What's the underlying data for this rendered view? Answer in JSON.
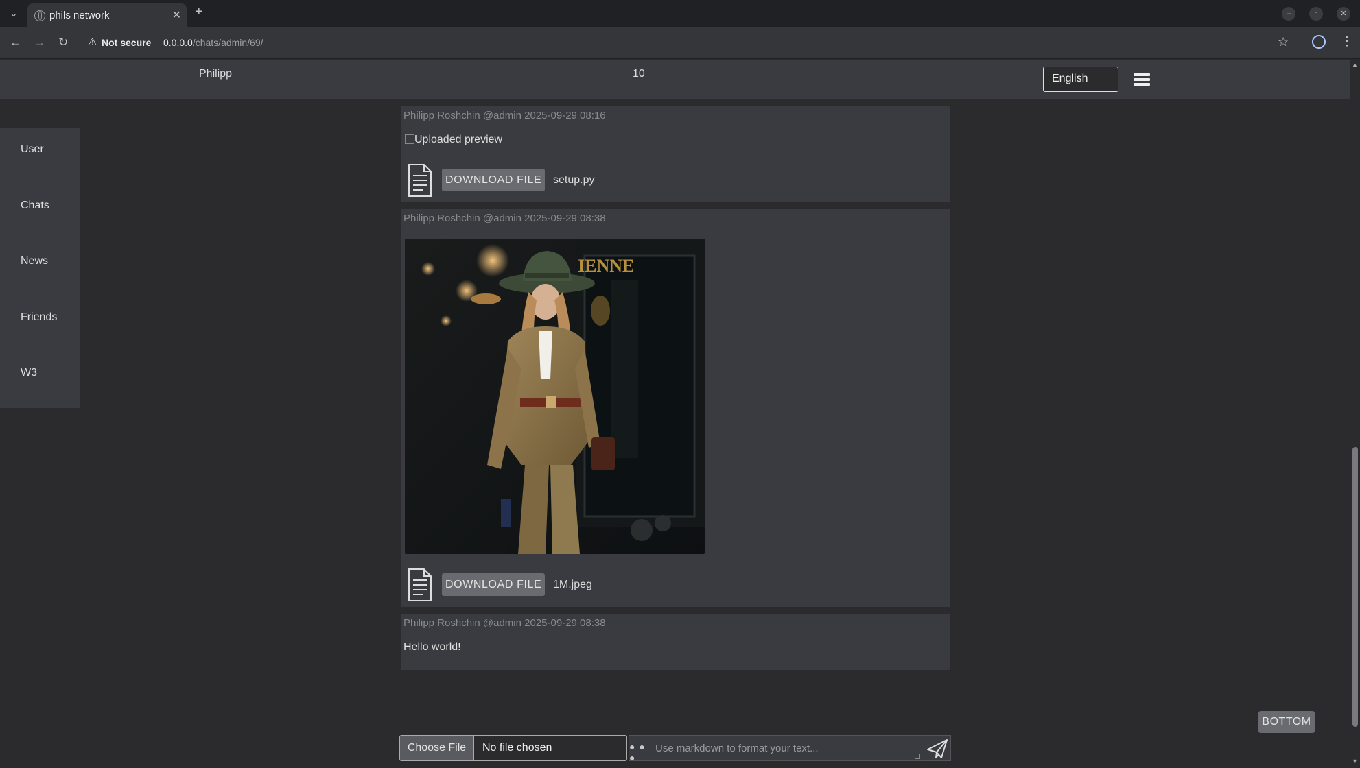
{
  "browser": {
    "tab_title": "phils network",
    "new_tab": "+",
    "tab_close": "✕",
    "security_label": "Not secure",
    "url_host": "0.0.0.0",
    "url_path": "/chats/admin/69/"
  },
  "header": {
    "user_name": "Philipp",
    "counter": "10",
    "language": "English"
  },
  "sidebar": {
    "items": [
      {
        "label": "User"
      },
      {
        "label": "Chats"
      },
      {
        "label": "News"
      },
      {
        "label": "Friends"
      },
      {
        "label": "W3"
      }
    ]
  },
  "messages": [
    {
      "meta": "Philipp Roshchin @admin 2025-09-29 08:16",
      "image_alt": "Uploaded preview",
      "download_label": "DOWNLOAD FILE",
      "file_name": "setup.py"
    },
    {
      "meta": "Philipp Roshchin @admin 2025-09-29 08:38",
      "download_label": "DOWNLOAD FILE",
      "file_name": "1M.jpeg"
    },
    {
      "meta": "Philipp Roshchin @admin 2025-09-29 08:38",
      "text": "Hello world!"
    }
  ],
  "controls": {
    "bottom_button": "BOTTOM",
    "choose_file": "Choose File",
    "no_file": "No file chosen",
    "text_placeholder": "Use markdown to format your text..."
  },
  "icons": {
    "file": "document-icon",
    "send": "paper-plane-icon",
    "menu": "hamburger-icon"
  },
  "colors": {
    "page_bg": "#2b2b2d",
    "panel_bg": "#3a3b40",
    "button_bg": "#6a6b70"
  }
}
